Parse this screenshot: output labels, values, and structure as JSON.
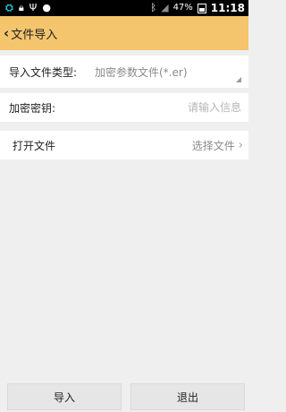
{
  "status_bar": {
    "battery_percent": "47%",
    "time": "11:18"
  },
  "header": {
    "title": "文件导入"
  },
  "form": {
    "file_type_label": "导入文件类型:",
    "file_type_value": "加密参数文件(*.er)",
    "key_label": "加密密钥:",
    "key_placeholder": "请输入信息",
    "open_file_label": "打开文件",
    "select_file_label": "选择文件"
  },
  "actions": {
    "import_label": "导入",
    "exit_label": "退出"
  }
}
